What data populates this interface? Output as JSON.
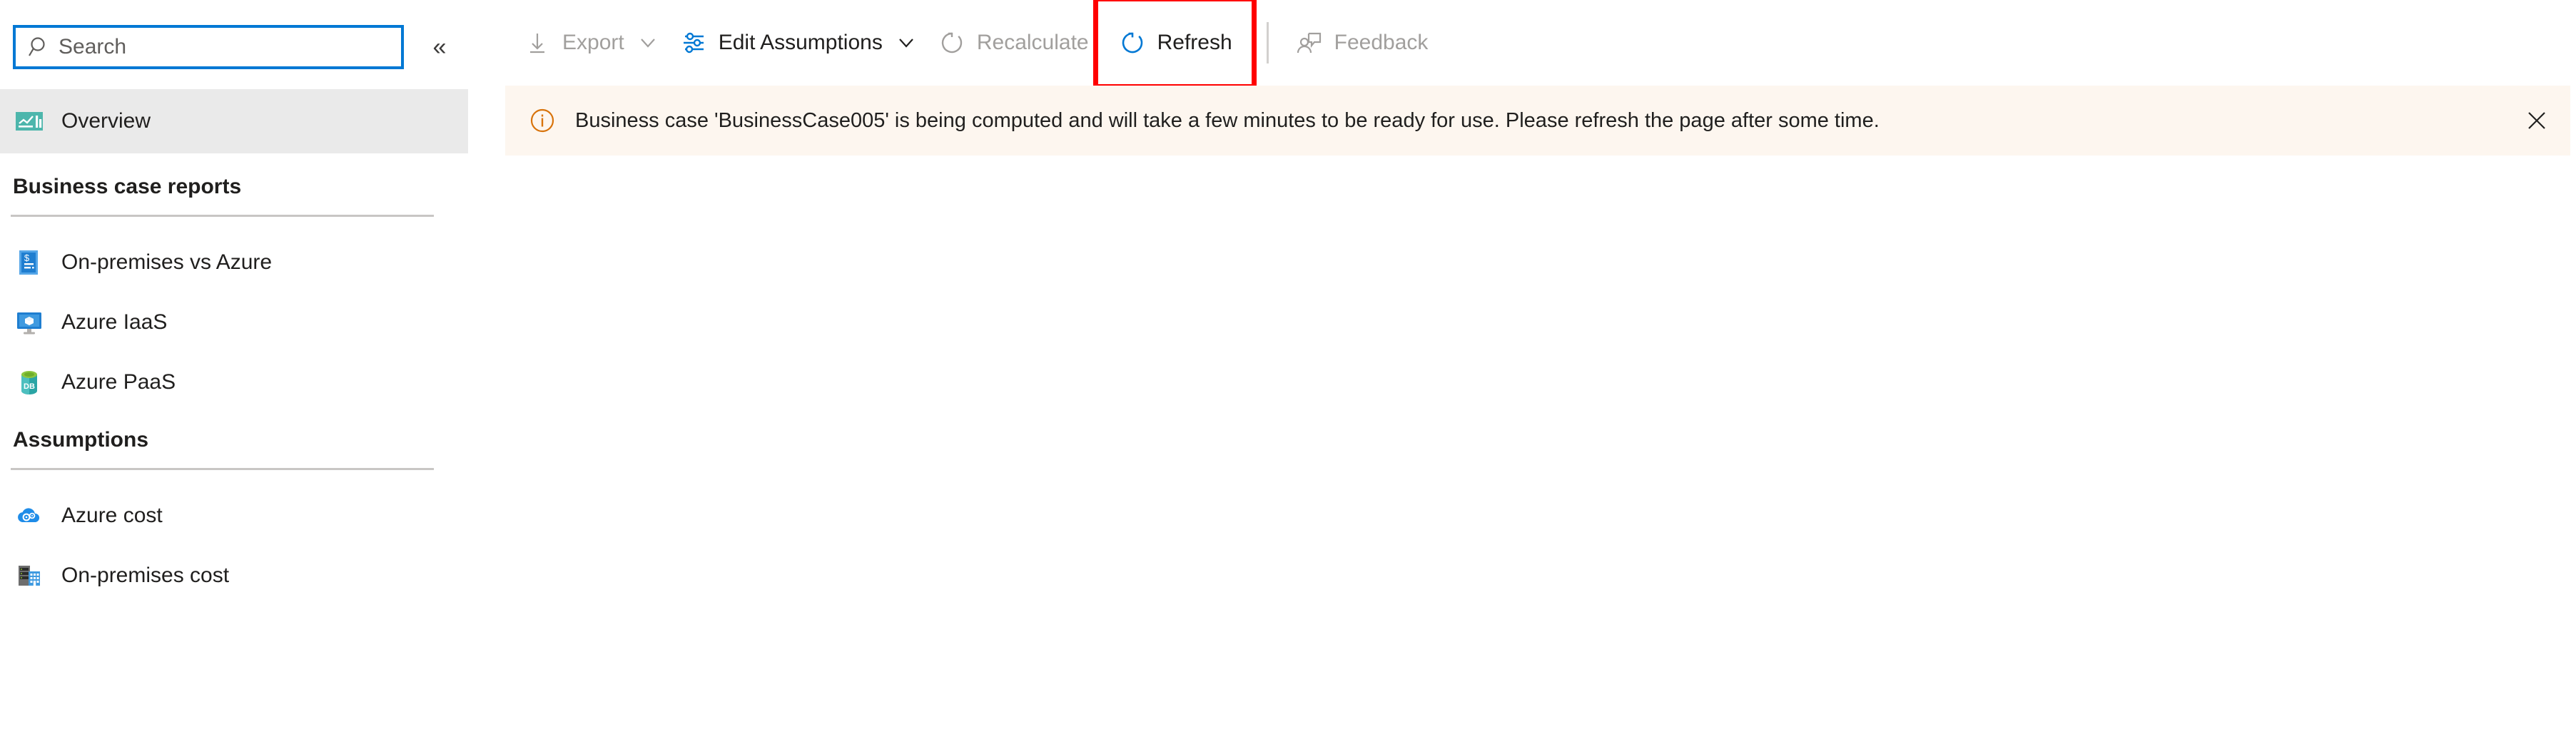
{
  "sidebar": {
    "search": {
      "placeholder": "Search",
      "value": "",
      "icon": "search-icon"
    },
    "collapse": {
      "label": "«",
      "icon": "chevron-double-left-icon"
    },
    "selected_item": {
      "label": "Overview",
      "icon": "overview-chart-icon"
    },
    "sections": [
      {
        "title": "Business case reports",
        "items": [
          {
            "label": "On-premises vs Azure",
            "icon": "invoice-document-icon"
          },
          {
            "label": "Azure IaaS",
            "icon": "monitor-vm-icon"
          },
          {
            "label": "Azure PaaS",
            "icon": "database-icon"
          }
        ]
      },
      {
        "title": "Assumptions",
        "items": [
          {
            "label": "Azure cost",
            "icon": "cloud-gears-icon"
          },
          {
            "label": "On-premises cost",
            "icon": "server-building-icon"
          }
        ]
      }
    ]
  },
  "toolbar": {
    "items": [
      {
        "label": "Export",
        "icon": "download-arrow-icon",
        "enabled": false,
        "has_caret": true
      },
      {
        "label": "Edit Assumptions",
        "icon": "sliders-icon",
        "enabled": true,
        "has_caret": true
      },
      {
        "label": "Recalculate",
        "icon": "circular-arrow-icon",
        "enabled": false,
        "has_caret": false
      },
      {
        "label": "Refresh",
        "icon": "refresh-circular-arrow-icon",
        "enabled": true,
        "has_caret": false,
        "highlighted": true
      },
      {
        "label": "Feedback",
        "icon": "person-feedback-icon",
        "enabled": false,
        "has_caret": false
      }
    ]
  },
  "banner": {
    "icon": "info-circle-icon",
    "message": "Business case 'BusinessCase005' is being computed and will take a few minutes to be ready for use. Please refresh the page after some time.",
    "close_label": "✕",
    "background": "#fdf6ef",
    "icon_color": "#d8730b"
  },
  "colors": {
    "accent_blue": "#0078d4",
    "highlight_red": "#ff0000",
    "selected_gray": "#eaeaea",
    "disabled_gray": "#a19f9d",
    "text_primary": "#201f1e"
  }
}
